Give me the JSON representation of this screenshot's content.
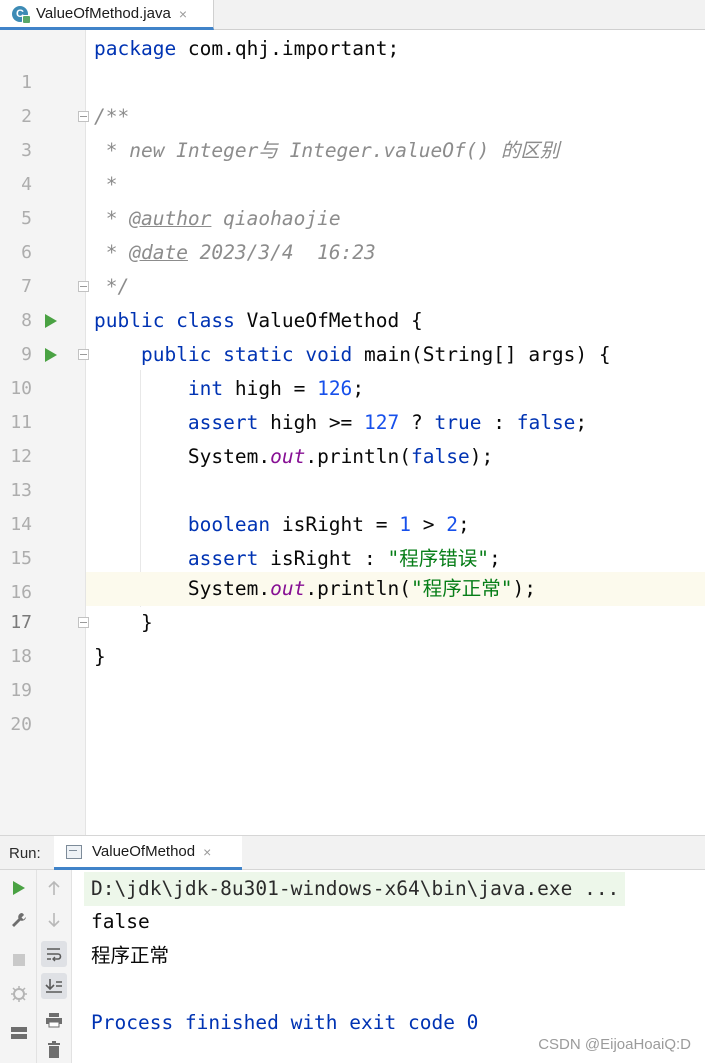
{
  "editor_tab": {
    "title": "ValueOfMethod.java",
    "close": "×"
  },
  "lines": [
    {
      "n": "1"
    },
    {
      "n": "2"
    },
    {
      "n": "3"
    },
    {
      "n": "4"
    },
    {
      "n": "5"
    },
    {
      "n": "6"
    },
    {
      "n": "7"
    },
    {
      "n": "8"
    },
    {
      "n": "9"
    },
    {
      "n": "10"
    },
    {
      "n": "11"
    },
    {
      "n": "12"
    },
    {
      "n": "13"
    },
    {
      "n": "14"
    },
    {
      "n": "15"
    },
    {
      "n": "16"
    },
    {
      "n": "17"
    },
    {
      "n": "18"
    },
    {
      "n": "19"
    },
    {
      "n": "20"
    }
  ],
  "code": {
    "l1": {
      "kw": "package",
      "rest": " com.qhj.important;"
    },
    "l3": "/**",
    "l4": " * new Integer与 Integer.valueOf() 的区别",
    "l5": " *",
    "l6": {
      "pre": " * ",
      "tag": "@author",
      "val": " qiaohaojie"
    },
    "l7": {
      "pre": " * ",
      "tag": "@date",
      "val": " 2023/3/4  16:23"
    },
    "l8": " */",
    "l9": {
      "kw": "public class",
      "rest": " ValueOfMethod {"
    },
    "l10": {
      "kw": "public static void",
      "rest1": " main",
      "rest2": "(String[] args) {"
    },
    "l11": {
      "kw": "int",
      "mid": " high = ",
      "num": "126",
      "end": ";"
    },
    "l12": {
      "kw": "assert",
      "mid": " high >= ",
      "num": "127",
      "q": " ? ",
      "t": "true",
      "c": " : ",
      "f": "false",
      "end": ";"
    },
    "l13": {
      "a": "System.",
      "field": "out",
      "b": ".println(",
      "kw": "false",
      "end": ");"
    },
    "l15": {
      "kw": "boolean",
      "mid": " isRight = ",
      "n1": "1",
      "op": " > ",
      "n2": "2",
      "end": ";"
    },
    "l16": {
      "kw": "assert",
      "mid": " isRight : ",
      "str": "\"程序错误\"",
      "end": ";"
    },
    "l17": {
      "a": "System.",
      "field": "out",
      "b": ".println(",
      "str": "\"程序正常\"",
      "end": ");"
    },
    "l18": "}",
    "l19": "}"
  },
  "run_panel": {
    "label": "Run:",
    "tab_title": "ValueOfMethod",
    "close": "×",
    "console": {
      "cmd": "D:\\jdk\\jdk-8u301-windows-x64\\bin\\java.exe ...",
      "out1": "false",
      "out2": "程序正常",
      "exit": "Process finished with exit code 0"
    }
  },
  "toolbar_icons": [
    "run-icon",
    "wrench-icon",
    "stop-icon",
    "debug-icon",
    "layout-icon",
    "arrow-up-icon",
    "arrow-down-icon",
    "soft-wrap-icon",
    "scroll-to-end-icon",
    "print-icon",
    "trash-icon"
  ],
  "watermark": "CSDN @EijoaHoaiQ:D",
  "colors": {
    "keyword": "#0033b3",
    "number": "#1750eb",
    "string": "#067d17",
    "comment": "#8c8c8c",
    "field": "#871094",
    "accent": "#4083c9",
    "run_green": "#4aa243"
  }
}
